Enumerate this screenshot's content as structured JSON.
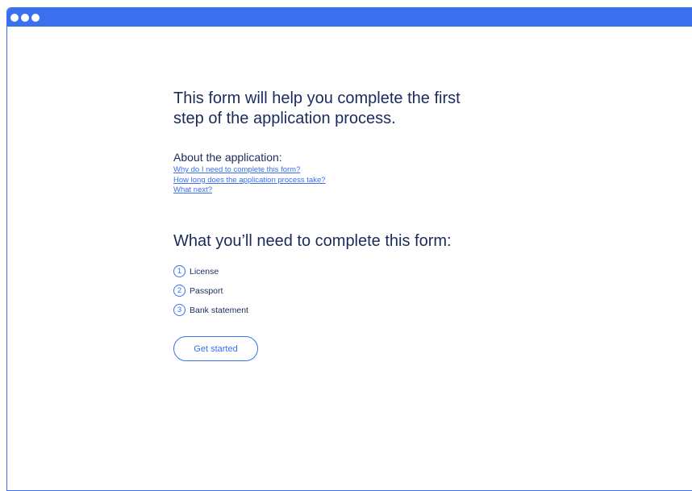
{
  "window": {
    "accent_color": "#3a6ff0",
    "controls": [
      "window-dot-icon",
      "window-dot-icon",
      "window-dot-icon"
    ]
  },
  "intro": {
    "headline_line1": "This form will help you complete the first",
    "headline_line2": "step of the application process."
  },
  "about": {
    "title": "About the application:",
    "links": [
      "Why do I need to complete this form?",
      "How long does the application process take?",
      "What next?"
    ]
  },
  "requirements": {
    "title": "What you’ll need to complete this form:",
    "items": [
      {
        "number": "1",
        "label": "License"
      },
      {
        "number": "2",
        "label": "Passport"
      },
      {
        "number": "3",
        "label": "Bank statement"
      }
    ]
  },
  "cta": {
    "label": "Get started"
  },
  "colors": {
    "text": "#1b2a5c",
    "link": "#3a6ff0"
  }
}
